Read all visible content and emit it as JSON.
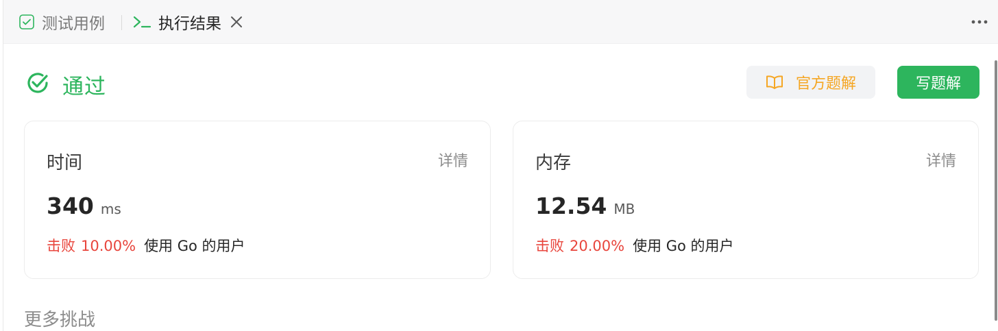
{
  "tabs": {
    "test_cases_label": "测试用例",
    "result_label": "执行结果",
    "test_cases_icon": "checkbox-icon",
    "result_icon": "terminal-icon",
    "close_icon": "close-icon",
    "more_icon": "more-horizontal-icon"
  },
  "status": {
    "text": "通过",
    "icon": "check-circle-icon",
    "color": "#2db55d"
  },
  "actions": {
    "official_solution_label": "官方题解",
    "official_solution_icon": "book-icon",
    "write_solution_label": "写题解"
  },
  "time_card": {
    "title": "时间",
    "detail_label": "详情",
    "value": "340",
    "unit": "ms",
    "beat_label": "击败",
    "beat_percent": "10.00%",
    "beat_suffix": "使用 Go 的用户"
  },
  "memory_card": {
    "title": "内存",
    "detail_label": "详情",
    "value": "12.54",
    "unit": "MB",
    "beat_label": "击败",
    "beat_percent": "20.00%",
    "beat_suffix": "使用 Go 的用户"
  },
  "more_challenges_label": "更多挑战",
  "colors": {
    "accent_green": "#2db55d",
    "warning_orange": "#f5a623",
    "beat_red": "#e8453c"
  }
}
